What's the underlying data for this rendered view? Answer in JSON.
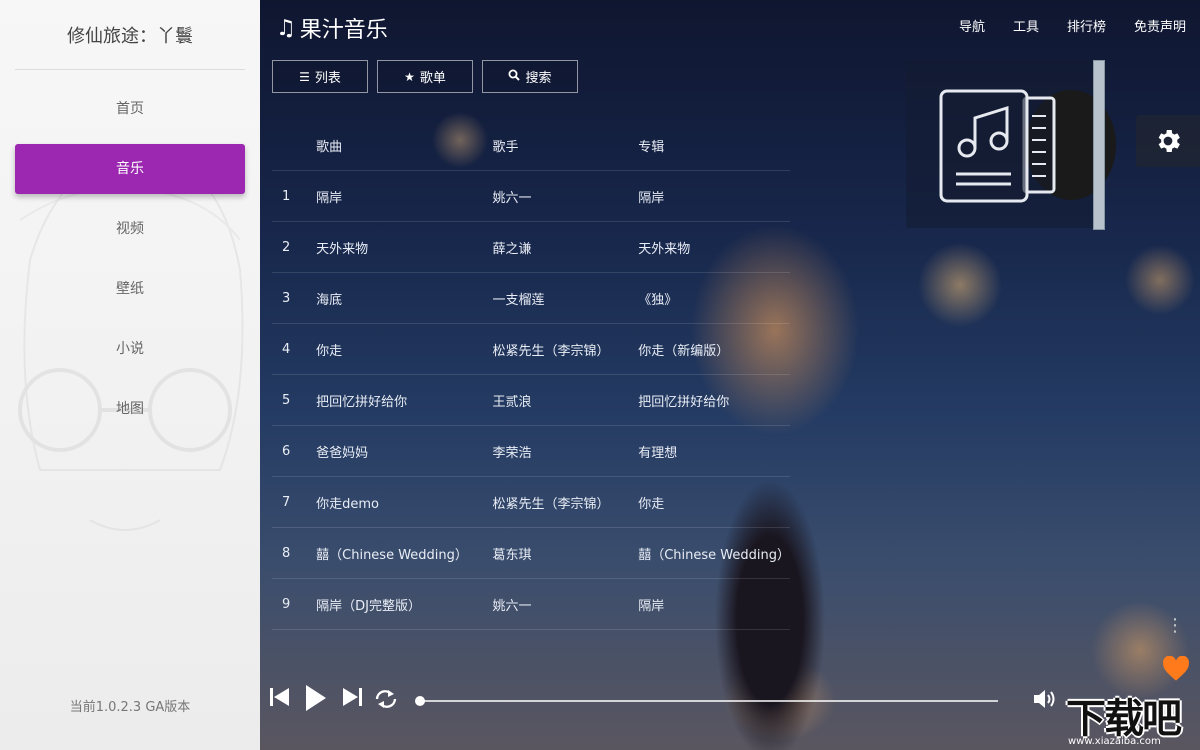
{
  "sidebar": {
    "title": "修仙旅途：丫鬟",
    "items": [
      {
        "label": "首页",
        "active": false
      },
      {
        "label": "音乐",
        "active": true
      },
      {
        "label": "视频",
        "active": false
      },
      {
        "label": "壁纸",
        "active": false
      },
      {
        "label": "小说",
        "active": false
      },
      {
        "label": "地图",
        "active": false
      }
    ],
    "version": "当前1.0.2.3 GA版本"
  },
  "header": {
    "brand_icon": "music-note-icon",
    "brand": "果汁音乐",
    "nav": [
      "导航",
      "工具",
      "排行榜",
      "免责声明"
    ]
  },
  "tabs": [
    {
      "icon": "list-icon",
      "label": "列表"
    },
    {
      "icon": "star-icon",
      "label": "歌单"
    },
    {
      "icon": "search-icon",
      "label": "搜索"
    }
  ],
  "table": {
    "headers": [
      "",
      "歌曲",
      "歌手",
      "专辑"
    ],
    "rows": [
      {
        "num": "1",
        "song": "隔岸",
        "artist": "姚六一",
        "album": "隔岸"
      },
      {
        "num": "2",
        "song": "天外来物",
        "artist": "薛之谦",
        "album": "天外来物"
      },
      {
        "num": "3",
        "song": "海底",
        "artist": "一支榴莲",
        "album": "《独》"
      },
      {
        "num": "4",
        "song": "你走",
        "artist": "松紧先生（李宗锦）",
        "album": "你走（新编版）"
      },
      {
        "num": "5",
        "song": "把回忆拼好给你",
        "artist": "王贰浪",
        "album": "把回忆拼好给你"
      },
      {
        "num": "6",
        "song": "爸爸妈妈",
        "artist": "李荣浩",
        "album": "有理想"
      },
      {
        "num": "7",
        "song": "你走demo",
        "artist": "松紧先生（李宗锦）",
        "album": "你走"
      },
      {
        "num": "8",
        "song": "囍（Chinese Wedding）",
        "artist": "葛东琪",
        "album": "囍（Chinese Wedding）"
      },
      {
        "num": "9",
        "song": "隔岸（DJ完整版）",
        "artist": "姚六一",
        "album": "隔岸"
      }
    ]
  },
  "player": {
    "progress": 0.0,
    "icons": [
      "previous-icon",
      "play-icon",
      "next-icon",
      "repeat-icon",
      "volume-icon"
    ]
  },
  "watermark": {
    "main": "下载吧",
    "sub": "www.xiazaiba.com"
  },
  "colors": {
    "accent": "#9c27b0",
    "favorite": "#ff7a1a"
  }
}
